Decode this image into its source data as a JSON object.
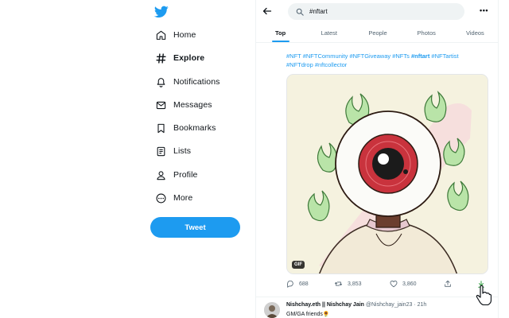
{
  "sidebar": {
    "items": [
      {
        "label": "Home",
        "icon": "home-icon"
      },
      {
        "label": "Explore",
        "icon": "hashtag-icon",
        "active": true
      },
      {
        "label": "Notifications",
        "icon": "bell-icon"
      },
      {
        "label": "Messages",
        "icon": "envelope-icon"
      },
      {
        "label": "Bookmarks",
        "icon": "bookmark-icon"
      },
      {
        "label": "Lists",
        "icon": "list-icon"
      },
      {
        "label": "Profile",
        "icon": "person-icon"
      },
      {
        "label": "More",
        "icon": "more-circle-icon"
      }
    ],
    "tweet_button": "Tweet"
  },
  "search": {
    "query": "#nftart"
  },
  "tabs": [
    "Top",
    "Latest",
    "People",
    "Photos",
    "Videos"
  ],
  "active_tab": "Top",
  "tweet": {
    "hashtags_line1": "#NFT #NFTCommunity #NFTGiveaway #NFTs ",
    "hashtag_highlight": "#nftart",
    "hashtags_line1_end": " #NFTartist",
    "hashtags_line2": "#NFTdrop #nftcollector",
    "media_badge": "GIF",
    "replies": "688",
    "retweets": "3,853",
    "likes": "3,860"
  },
  "next_tweet": {
    "name": "Nishchay.eth || Nishchay Jain",
    "handle": "@Nishchay_jain23 · 21h",
    "text": "GM/GA friends🌻"
  },
  "colors": {
    "accent": "#1d9bf0",
    "text": "#0f1419",
    "muted": "#536471"
  }
}
